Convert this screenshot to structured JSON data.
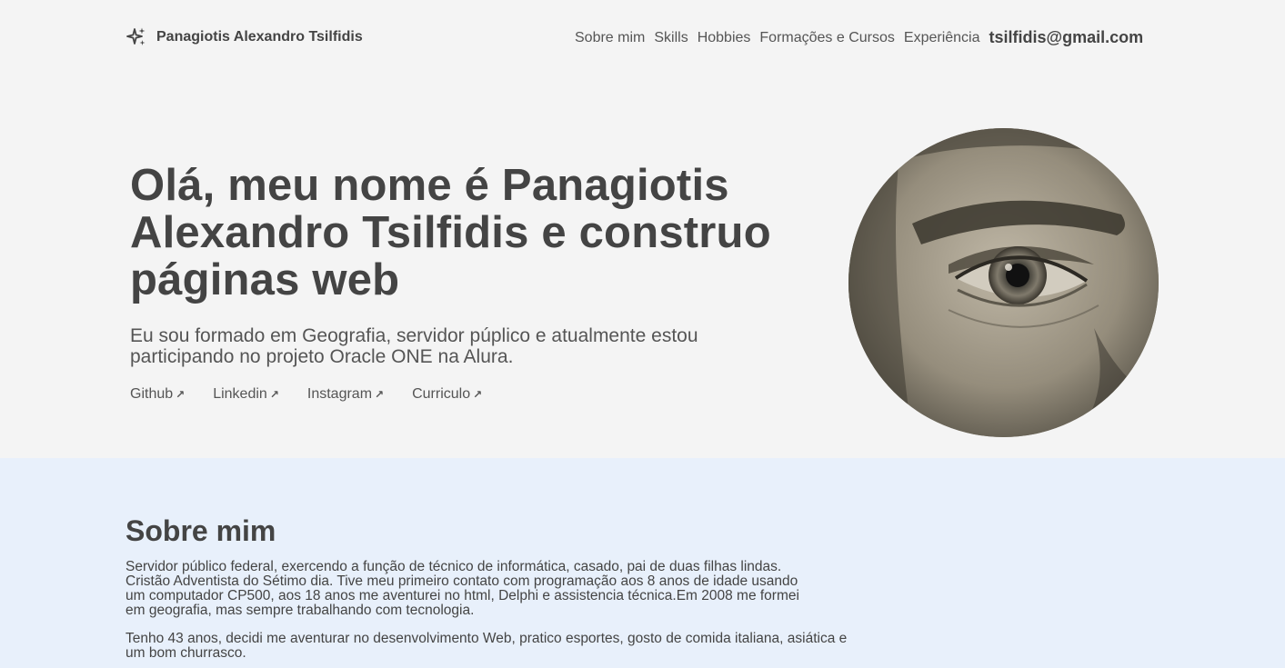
{
  "header": {
    "brand_icon": "sparkles-icon",
    "brand_name": "Panagiotis Alexandro Tsilfidis",
    "nav": [
      {
        "label": "Sobre mim"
      },
      {
        "label": "Skills"
      },
      {
        "label": "Hobbies"
      },
      {
        "label": "Formações e Cursos"
      },
      {
        "label": "Experiência"
      }
    ],
    "email": "tsilfidis@gmail.com"
  },
  "hero": {
    "title": "Olá, meu nome é Panagiotis Alexandro Tsilfidis e construo páginas web",
    "subtitle": "Eu sou formado em Geografia, servidor púplico e atualmente estou participando no projeto Oracle ONE na Alura.",
    "links": [
      {
        "label": "Github",
        "icon": "arrow-up-right-icon"
      },
      {
        "label": "Linkedin",
        "icon": "arrow-up-right-icon"
      },
      {
        "label": "Instagram",
        "icon": "arrow-up-right-icon"
      },
      {
        "label": "Curriculo",
        "icon": "arrow-up-right-icon"
      }
    ]
  },
  "about": {
    "title": "Sobre mim",
    "paragraph1": "Servidor público federal, exercendo a função de técnico de informática, casado, pai de duas filhas lindas. Cristão Adventista do Sétimo dia. Tive meu primeiro contato com programação aos 8 anos de idade usando um computador CP500, aos 18 anos me aventurei no html, Delphi e assistencia técnica.Em 2008 me formei em geografia, mas sempre trabalhando com tecnologia.",
    "paragraph2": "Tenho 43 anos, decidi me aventurar no desenvolvimento Web, pratico esportes, gosto de comida italiana, asiática e um bom churrasco."
  }
}
